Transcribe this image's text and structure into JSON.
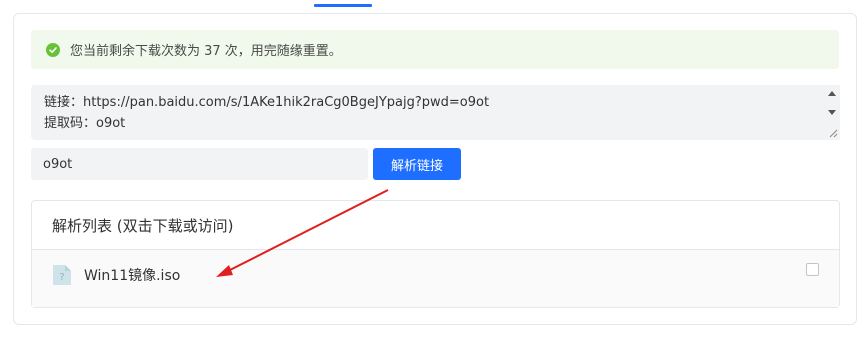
{
  "alert": {
    "message": "您当前剩余下载次数为 37 次，用完随缘重置。",
    "icon": "check-circle-icon",
    "color": "#67c23a"
  },
  "share": {
    "link_line": "链接：https://pan.baidu.com/s/1AKe1hik2raCg0BgeJYpajg?pwd=o9ot",
    "code_line": "提取码：o9ot"
  },
  "extract_code": {
    "value": "o9ot"
  },
  "parse_button": {
    "label": "解析链接",
    "color": "#1e6fff"
  },
  "result_list": {
    "title": "解析列表 (双击下载或访问)",
    "items": [
      {
        "name": "Win11镜像.iso",
        "icon": "unknown-file-icon",
        "checked": false
      }
    ]
  },
  "annotation": {
    "arrow_color": "#e02020"
  }
}
